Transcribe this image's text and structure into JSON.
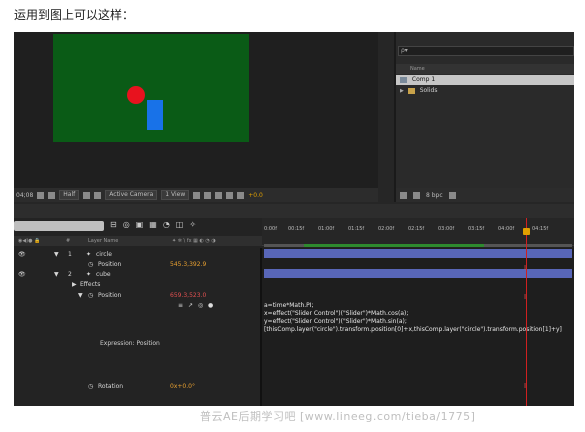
{
  "caption": "运用到图上可以这样：",
  "comp_toolbar": {
    "timecode": "04;08",
    "resolution": "Half",
    "camera": "Active Camera",
    "view": "1 View",
    "exposure": "+0.0"
  },
  "project": {
    "search_placeholder": "ρ▾",
    "column_name": "Name",
    "items": [
      {
        "label": "Comp 1",
        "selected": true
      },
      {
        "label": "Solids",
        "selected": false
      }
    ],
    "bpc": "8 bpc"
  },
  "timeline": {
    "ruler": [
      "0:00f",
      "00:15f",
      "01:00f",
      "01:15f",
      "02:00f",
      "02:15f",
      "03:00f",
      "03:15f",
      "04:00f",
      "04:15f"
    ],
    "layer_header": "Layer Name",
    "layers": [
      {
        "num": "1",
        "name": "circle",
        "prop": "Position",
        "value": "545.3,392.9"
      },
      {
        "num": "2",
        "name": "cube",
        "effects": "Effects",
        "prop": "Position",
        "value": "659.3,523.0"
      }
    ],
    "expression_label": "Expression: Position",
    "expression_lines": [
      "a=time*Math.PI;",
      "x=effect(\"Slider Control\")(\"Slider\")*Math.cos(a);",
      "y=effect(\"Slider Control\")(\"Slider\")*Math.sin(a);",
      "[thisComp.layer(\"circle\").transform.position[0]+x,thisComp.layer(\"circle\").transform.position[1]+y]"
    ],
    "rotation_label": "Rotation",
    "rotation_value": "0x+0.0°"
  },
  "watermark": "普云AE后期学习吧  [www.lineeg.com/tieba/1775]",
  "colors": {
    "comp_bg": "#0a5b16",
    "circle": "#e8121e",
    "cube": "#1872e8",
    "track": "#5866b8",
    "ctl": "#d02020"
  }
}
